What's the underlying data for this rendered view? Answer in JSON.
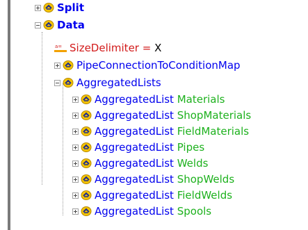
{
  "tree": {
    "split": {
      "label": "Split"
    },
    "data": {
      "label": "Data"
    },
    "size_delimiter": {
      "name": "SizeDelimiter",
      "eq": " = ",
      "value": "X"
    },
    "pipe_map": {
      "label": "PipeConnectionToConditionMap"
    },
    "aggregated_lists": {
      "label": "AggregatedLists"
    },
    "items": [
      {
        "type": "AggregatedList",
        "name": "Materials"
      },
      {
        "type": "AggregatedList",
        "name": "ShopMaterials"
      },
      {
        "type": "AggregatedList",
        "name": "FieldMaterials"
      },
      {
        "type": "AggregatedList",
        "name": "Pipes"
      },
      {
        "type": "AggregatedList",
        "name": "Welds"
      },
      {
        "type": "AggregatedList",
        "name": "ShopWelds"
      },
      {
        "type": "AggregatedList",
        "name": "FieldWelds"
      },
      {
        "type": "AggregatedList",
        "name": "Spools"
      }
    ]
  }
}
